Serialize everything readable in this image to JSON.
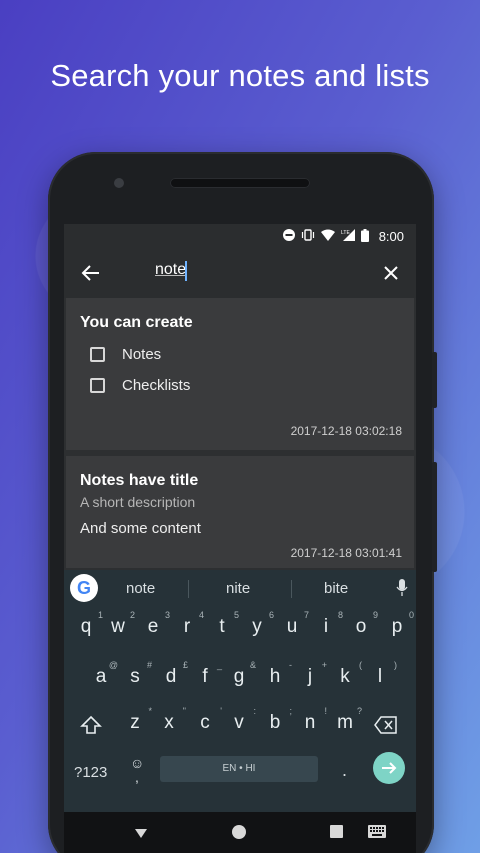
{
  "headline": "Search your notes and lists",
  "status_bar": {
    "time": "8:00",
    "icons": [
      "dnd-icon",
      "vibrate-icon",
      "wifi-icon",
      "lte-signal-icon",
      "battery-icon"
    ]
  },
  "search": {
    "query": "note"
  },
  "notes": [
    {
      "title": "You can create",
      "checklist": [
        {
          "label": "Notes",
          "checked": false
        },
        {
          "label": "Checklists",
          "checked": false
        }
      ],
      "date": "2017-12-18 03:02:18"
    },
    {
      "title": "Notes have title",
      "subtitle": "A short description",
      "content": "And some content",
      "date": "2017-12-18 03:01:41"
    }
  ],
  "keyboard": {
    "suggestions": [
      "note",
      "nite",
      "bite"
    ],
    "row1": [
      {
        "k": "q",
        "h": "1"
      },
      {
        "k": "w",
        "h": "2"
      },
      {
        "k": "e",
        "h": "3"
      },
      {
        "k": "r",
        "h": "4"
      },
      {
        "k": "t",
        "h": "5"
      },
      {
        "k": "y",
        "h": "6"
      },
      {
        "k": "u",
        "h": "7"
      },
      {
        "k": "i",
        "h": "8"
      },
      {
        "k": "o",
        "h": "9"
      },
      {
        "k": "p",
        "h": "0"
      }
    ],
    "row2": [
      {
        "k": "a",
        "h": "@"
      },
      {
        "k": "s",
        "h": "#"
      },
      {
        "k": "d",
        "h": "£"
      },
      {
        "k": "f",
        "h": "_"
      },
      {
        "k": "g",
        "h": "&"
      },
      {
        "k": "h",
        "h": "-"
      },
      {
        "k": "j",
        "h": "+"
      },
      {
        "k": "k",
        "h": "("
      },
      {
        "k": "l",
        "h": ")"
      }
    ],
    "row3": [
      {
        "k": "z",
        "h": "*"
      },
      {
        "k": "x",
        "h": "\""
      },
      {
        "k": "c",
        "h": "'"
      },
      {
        "k": "v",
        "h": ":"
      },
      {
        "k": "b",
        "h": ";"
      },
      {
        "k": "n",
        "h": "!"
      },
      {
        "k": "m",
        "h": "?"
      }
    ],
    "symbols_label": "?123",
    "emoji_label": "☺",
    "comma_label": ",",
    "space_label": "EN • HI",
    "period_label": "."
  },
  "colors": {
    "accent_enter": "#7ed4c6",
    "card_bg": "#3a3b3d",
    "keyboard_bg": "#263238"
  }
}
